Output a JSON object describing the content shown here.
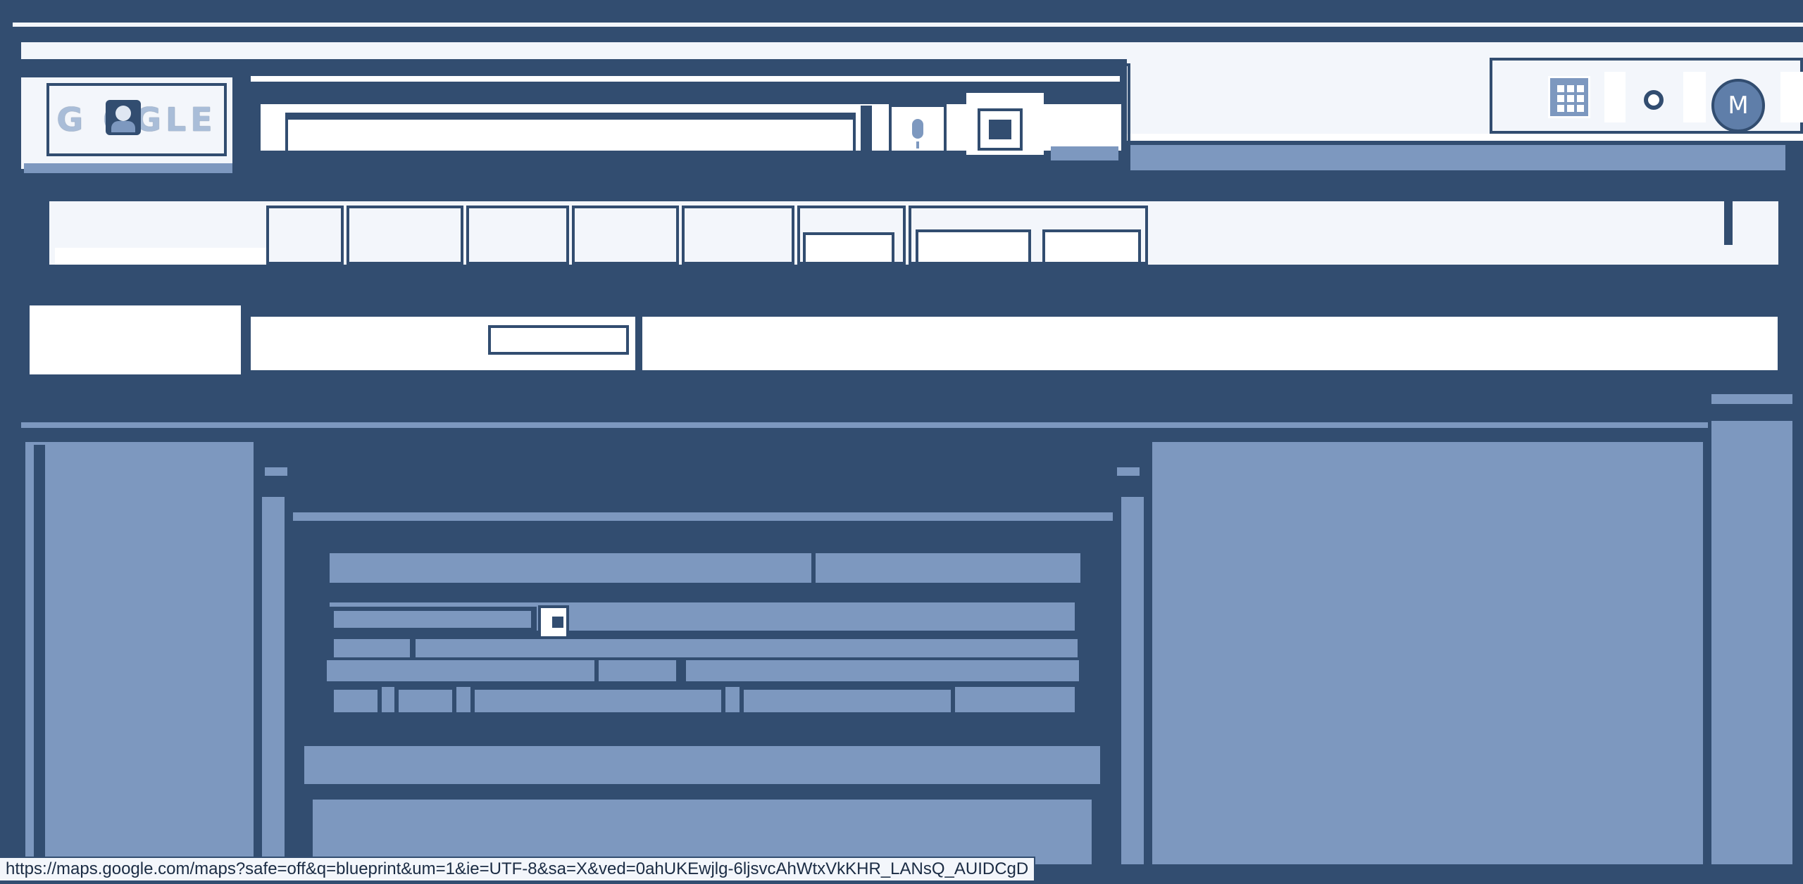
{
  "header": {
    "search_query": "",
    "account_initial": "M",
    "icons": [
      "apps-grid-icon",
      "notifications-icon",
      "microphone-icon",
      "camera-search-icon"
    ]
  },
  "status_bar": {
    "url": "https://maps.google.com/maps?safe=off&q=blueprint&um=1&ie=UTF-8&sa=X&ved=0ahUKEwjlg-6ljsvcAhWtxVkKHR_LANsQ_AUIDCgD"
  },
  "colors": {
    "dark": "#324d70",
    "light": "#f3f6fb",
    "mid": "#7d98bf"
  }
}
